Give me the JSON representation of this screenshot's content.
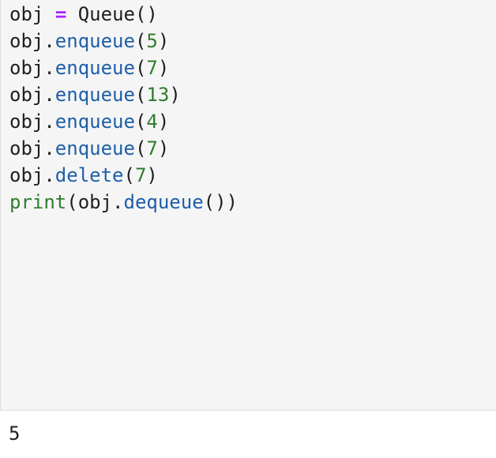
{
  "code_lines": [
    [
      {
        "text": "obj",
        "kind": "plain"
      },
      {
        "text": " ",
        "kind": "plain"
      },
      {
        "text": "=",
        "kind": "op"
      },
      {
        "text": " Queue()",
        "kind": "plain"
      }
    ],
    [
      {
        "text": "obj.",
        "kind": "plain"
      },
      {
        "text": "enqueue",
        "kind": "method"
      },
      {
        "text": "(",
        "kind": "plain"
      },
      {
        "text": "5",
        "kind": "num"
      },
      {
        "text": ")",
        "kind": "plain"
      }
    ],
    [
      {
        "text": "obj.",
        "kind": "plain"
      },
      {
        "text": "enqueue",
        "kind": "method"
      },
      {
        "text": "(",
        "kind": "plain"
      },
      {
        "text": "7",
        "kind": "num"
      },
      {
        "text": ")",
        "kind": "plain"
      }
    ],
    [
      {
        "text": "obj.",
        "kind": "plain"
      },
      {
        "text": "enqueue",
        "kind": "method"
      },
      {
        "text": "(",
        "kind": "plain"
      },
      {
        "text": "13",
        "kind": "num"
      },
      {
        "text": ")",
        "kind": "plain"
      }
    ],
    [
      {
        "text": "obj.",
        "kind": "plain"
      },
      {
        "text": "enqueue",
        "kind": "method"
      },
      {
        "text": "(",
        "kind": "plain"
      },
      {
        "text": "4",
        "kind": "num"
      },
      {
        "text": ")",
        "kind": "plain"
      }
    ],
    [
      {
        "text": "obj.",
        "kind": "plain"
      },
      {
        "text": "enqueue",
        "kind": "method"
      },
      {
        "text": "(",
        "kind": "plain"
      },
      {
        "text": "7",
        "kind": "num"
      },
      {
        "text": ")",
        "kind": "plain"
      }
    ],
    [
      {
        "text": "obj.",
        "kind": "plain"
      },
      {
        "text": "delete",
        "kind": "method"
      },
      {
        "text": "(",
        "kind": "plain"
      },
      {
        "text": "7",
        "kind": "num"
      },
      {
        "text": ")",
        "kind": "plain"
      }
    ],
    [
      {
        "text": "print",
        "kind": "builtin"
      },
      {
        "text": "(obj.",
        "kind": "plain"
      },
      {
        "text": "dequeue",
        "kind": "method"
      },
      {
        "text": "())",
        "kind": "plain"
      }
    ]
  ],
  "output_text": "5",
  "colors": {
    "cell_background": "#f5f5f5",
    "method": "#1e5fa8",
    "number": "#2e7d2e",
    "builtin": "#2e7d2e",
    "operator": "#aa22ff"
  }
}
